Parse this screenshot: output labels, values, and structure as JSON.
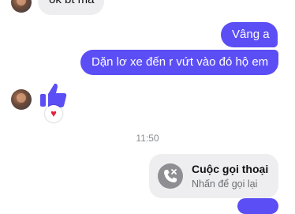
{
  "messages": {
    "incoming_1": "ok bt mà",
    "outgoing_1": "Vâng a",
    "outgoing_2": "Dặn lơ xe đến r vứt vào đó hộ em",
    "reaction_emoji": "♥"
  },
  "timestamp": "11:50",
  "call": {
    "title": "Cuộc gọi thoại",
    "subtitle": "Nhấn để gọi lại",
    "icon": "missed-call-icon"
  },
  "colors": {
    "outgoing_bubble": "#5b4ef5",
    "incoming_bubble": "#eeeef0",
    "like": "#5b4ef5",
    "reaction": "#e41e3f"
  }
}
